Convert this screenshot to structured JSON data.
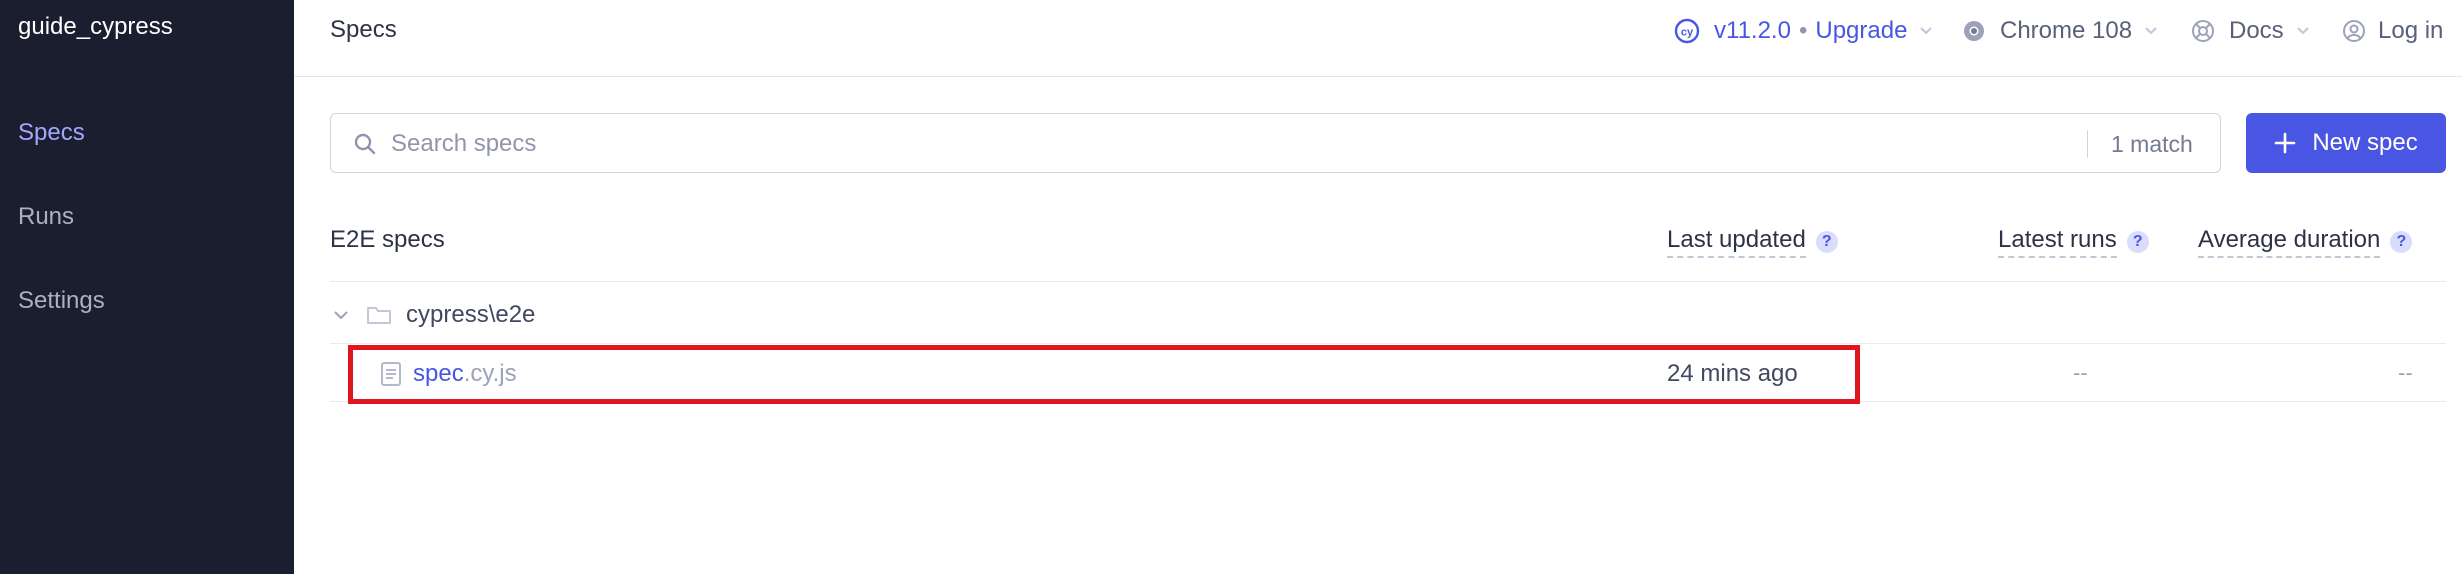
{
  "sidebar": {
    "project_name": "guide_cypress",
    "items": [
      {
        "label": "Specs",
        "active": true
      },
      {
        "label": "Runs",
        "active": false
      },
      {
        "label": "Settings",
        "active": false
      }
    ]
  },
  "header": {
    "title": "Specs",
    "version": "v11.2.0",
    "separator": "•",
    "upgrade": "Upgrade",
    "browser": "Chrome 108",
    "docs": "Docs",
    "login": "Log in"
  },
  "search": {
    "placeholder": "Search specs",
    "value": "",
    "match_count": "1 match"
  },
  "new_spec_label": "New spec",
  "table": {
    "section_title": "E2E specs",
    "columns": [
      "Last updated",
      "Latest runs",
      "Average duration"
    ],
    "help_glyph": "?",
    "folder": "cypress\\e2e",
    "rows": [
      {
        "name": "spec",
        "ext": ".cy.js",
        "last_updated": "24 mins ago",
        "latest_runs": "--",
        "avg_duration": "--"
      }
    ]
  },
  "colors": {
    "sidebar_bg": "#1b1e2e",
    "accent": "#4956e3",
    "active_nav": "#a3a7ff",
    "highlight": "#e0161e"
  },
  "icons": [
    "search-icon",
    "plus-icon",
    "cypress-logo-icon",
    "chrome-icon",
    "docs-icon",
    "user-icon",
    "chevron-down-icon",
    "folder-icon",
    "file-icon",
    "help-icon"
  ]
}
